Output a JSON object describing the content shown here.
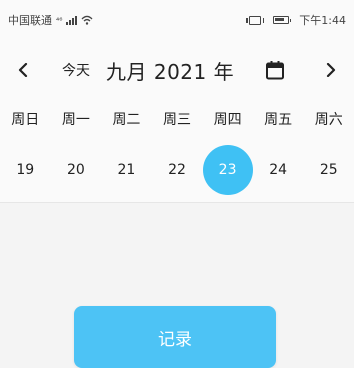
{
  "status_bar": {
    "carrier": "中国联通",
    "network": "⁴⁶",
    "time": "下午1:44"
  },
  "header": {
    "today_label": "今天",
    "month_title": "九月 2021 年"
  },
  "weekdays": [
    "周日",
    "周一",
    "周二",
    "周三",
    "周四",
    "周五",
    "周六"
  ],
  "dates": [
    {
      "label": "19",
      "selected": false
    },
    {
      "label": "20",
      "selected": false
    },
    {
      "label": "21",
      "selected": false
    },
    {
      "label": "22",
      "selected": false
    },
    {
      "label": "23",
      "selected": true
    },
    {
      "label": "24",
      "selected": false
    },
    {
      "label": "25",
      "selected": false
    }
  ],
  "record_button": {
    "label": "记录"
  },
  "colors": {
    "accent": "#3fc1f4",
    "button": "#4dc3f5",
    "background": "#f4f4f4"
  },
  "icons": {
    "prev": "chevron-left-icon",
    "next": "chevron-right-icon",
    "calendar": "calendar-icon",
    "signal": "signal-icon",
    "wifi": "wifi-icon",
    "vibrate": "vibrate-icon",
    "battery": "battery-icon"
  }
}
